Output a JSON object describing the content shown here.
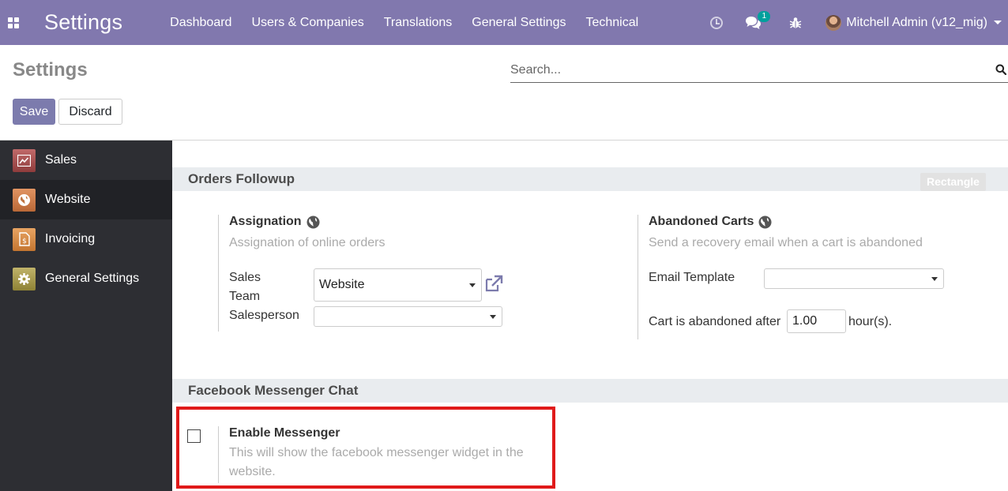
{
  "navbar": {
    "brand": "Settings",
    "menu": [
      "Dashboard",
      "Users & Companies",
      "Translations",
      "General Settings",
      "Technical"
    ],
    "chat_badge": "1",
    "user": "Mitchell Admin (v12_mig)"
  },
  "control_panel": {
    "title": "Settings",
    "search_placeholder": "Search...",
    "save_label": "Save",
    "discard_label": "Discard"
  },
  "sidebar": {
    "items": [
      {
        "label": "Sales",
        "icon": "sales-icon"
      },
      {
        "label": "Website",
        "icon": "website-icon"
      },
      {
        "label": "Invoicing",
        "icon": "invoicing-icon"
      },
      {
        "label": "General Settings",
        "icon": "gear-icon"
      }
    ],
    "active_index": 1
  },
  "orders_followup": {
    "heading": "Orders Followup",
    "badge": "Rectangle",
    "assignation": {
      "title": "Assignation",
      "help": "Assignation of online orders",
      "sales_team_label_1": "Sales",
      "sales_team_label_2": "Team",
      "sales_team_value": "Website",
      "salesperson_label": "Salesperson",
      "salesperson_value": ""
    },
    "abandoned_carts": {
      "title": "Abandoned Carts",
      "help": "Send a recovery email when a cart is abandoned",
      "email_template_label": "Email Template",
      "email_template_value": "",
      "abandoned_after_label": "Cart is abandoned after",
      "abandoned_after_value": "1.00",
      "abandoned_after_unit": "hour(s)."
    }
  },
  "facebook": {
    "heading": "Facebook Messenger Chat",
    "enable_title": "Enable Messenger",
    "enable_help": "This will show the facebook messenger widget in the website."
  },
  "colors": {
    "navbar": "#8178ae",
    "primary_button": "#7c7bad",
    "sidebar": "#2d2e33",
    "highlight": "#e01a1a"
  }
}
